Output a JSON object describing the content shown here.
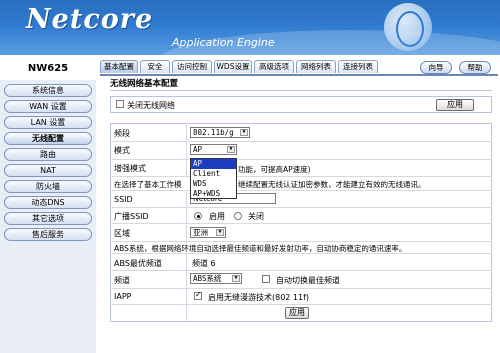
{
  "header": {
    "logo": "Netcore",
    "subtitle": "Application Engine"
  },
  "sidebar": {
    "model": "NW625",
    "items": [
      {
        "label": "系统信息"
      },
      {
        "label": "WAN 设置"
      },
      {
        "label": "LAN 设置"
      },
      {
        "label": "无线配置"
      },
      {
        "label": "路由"
      },
      {
        "label": "NAT"
      },
      {
        "label": "防火墙"
      },
      {
        "label": "动态DNS"
      },
      {
        "label": "其它选项"
      },
      {
        "label": "售后服务"
      }
    ]
  },
  "tabs": [
    {
      "label": "基本配置"
    },
    {
      "label": "安全"
    },
    {
      "label": "访问控制"
    },
    {
      "label": "WDS设置"
    },
    {
      "label": "高级选项"
    },
    {
      "label": "网络列表"
    },
    {
      "label": "连接列表"
    }
  ],
  "top_buttons": {
    "wizard": "向导",
    "help": "帮助"
  },
  "page": {
    "title": "无线网络基本配置",
    "disable_wireless_label": "关闭无线网络",
    "apply_label": "应用",
    "band_label": "频段",
    "band_value": "802.11b/g",
    "mode_label": "模式",
    "mode_value": "AP",
    "mode_options": [
      "AP",
      "Client",
      "WDS",
      "AP+WDS"
    ],
    "enhanced_label": "增强模式",
    "enhanced_note": "功能，可提高AP速度)",
    "notice_text": "在选择了基本工作模",
    "notice_text2": "继续配置无线认证加密参数，才能建立有效的无线通讯。",
    "ssid_label": "SSID",
    "ssid_value": "Netcore",
    "broadcast_label": "广播SSID",
    "broadcast_on": "启用",
    "broadcast_off": "关闭",
    "region_label": "区域",
    "region_value": "亚洲",
    "abs_desc": "ABS系统，根据网络环境自动选择最佳频道和最好发射功率，自动协商稳定的通讯速率。",
    "abs_best_label": "ABS最优频道",
    "abs_best_value": "频道 6",
    "channel_label": "频道",
    "channel_value": "ABS系统",
    "auto_switch_label": "自动切换最佳频道",
    "iapp_label": "IAPP",
    "iapp_text": "启用无缝漫游技术(802 11f)",
    "bottom_apply_label": "应用"
  }
}
